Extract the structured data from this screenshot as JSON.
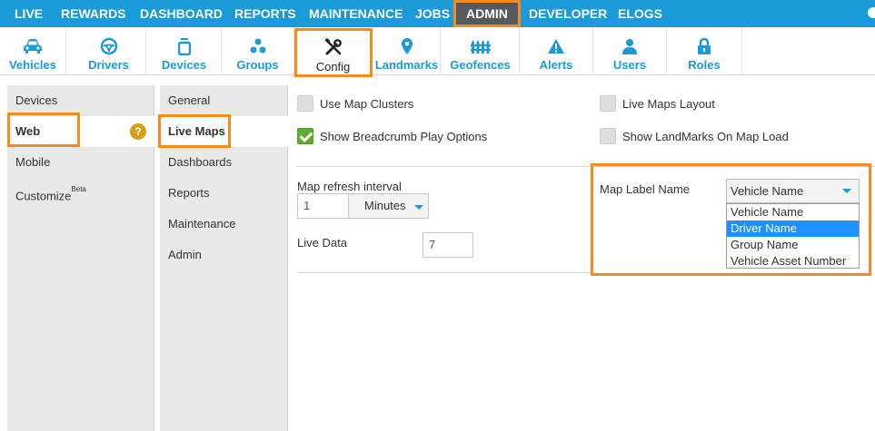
{
  "colors": {
    "brand": "#1a9ad6",
    "highlight": "#f58a1f",
    "checked": "#5cae2e",
    "badge": "#d4a017"
  },
  "topnav": {
    "items": [
      {
        "label": "LIVE"
      },
      {
        "label": "REWARDS"
      },
      {
        "label": "DASHBOARD"
      },
      {
        "label": "REPORTS"
      },
      {
        "label": "MAINTENANCE"
      },
      {
        "label": "JOBS"
      },
      {
        "label": "ADMIN",
        "active": true
      },
      {
        "label": "DEVELOPER"
      },
      {
        "label": "ELOGS"
      }
    ]
  },
  "iconbar": {
    "tabs": [
      {
        "label": "Vehicles",
        "icon": "car-icon"
      },
      {
        "label": "Drivers",
        "icon": "steering-wheel-icon"
      },
      {
        "label": "Devices",
        "icon": "device-icon"
      },
      {
        "label": "Groups",
        "icon": "group-icon"
      },
      {
        "label": "Config",
        "icon": "wrench-screwdriver-icon",
        "active": true
      },
      {
        "label": "Landmarks",
        "icon": "map-pin-icon"
      },
      {
        "label": "Geofences",
        "icon": "fence-icon"
      },
      {
        "label": "Alerts",
        "icon": "warning-icon"
      },
      {
        "label": "Users",
        "icon": "user-icon"
      },
      {
        "label": "Roles",
        "icon": "lock-icon"
      }
    ]
  },
  "sidebar1": {
    "items": [
      {
        "label": "Devices"
      },
      {
        "label": "Web",
        "active": true,
        "help": "?"
      },
      {
        "label": "Mobile"
      },
      {
        "label": "Customize",
        "sup": "Beta"
      }
    ]
  },
  "sidebar2": {
    "items": [
      {
        "label": "General"
      },
      {
        "label": "Live Maps",
        "active": true
      },
      {
        "label": "Dashboards"
      },
      {
        "label": "Reports"
      },
      {
        "label": "Maintenance"
      },
      {
        "label": "Admin"
      }
    ]
  },
  "settings": {
    "use_map_clusters": {
      "label": "Use Map Clusters",
      "checked": false
    },
    "live_maps_layout": {
      "label": "Live Maps Layout",
      "checked": false
    },
    "show_breadcrumb": {
      "label": "Show Breadcrumb Play Options",
      "checked": true
    },
    "show_landmarks": {
      "label": "Show LandMarks On Map Load",
      "checked": false
    },
    "refresh_interval": {
      "label": "Map refresh interval",
      "value": "1",
      "unit": "Minutes"
    },
    "live_data": {
      "label": "Live Data",
      "value": "7"
    },
    "map_label_name": {
      "label": "Map Label Name",
      "selected": "Vehicle Name",
      "options": [
        "Vehicle Name",
        "Driver Name",
        "Group Name",
        "Vehicle Asset Number"
      ],
      "highlighted_option": "Driver Name"
    }
  }
}
